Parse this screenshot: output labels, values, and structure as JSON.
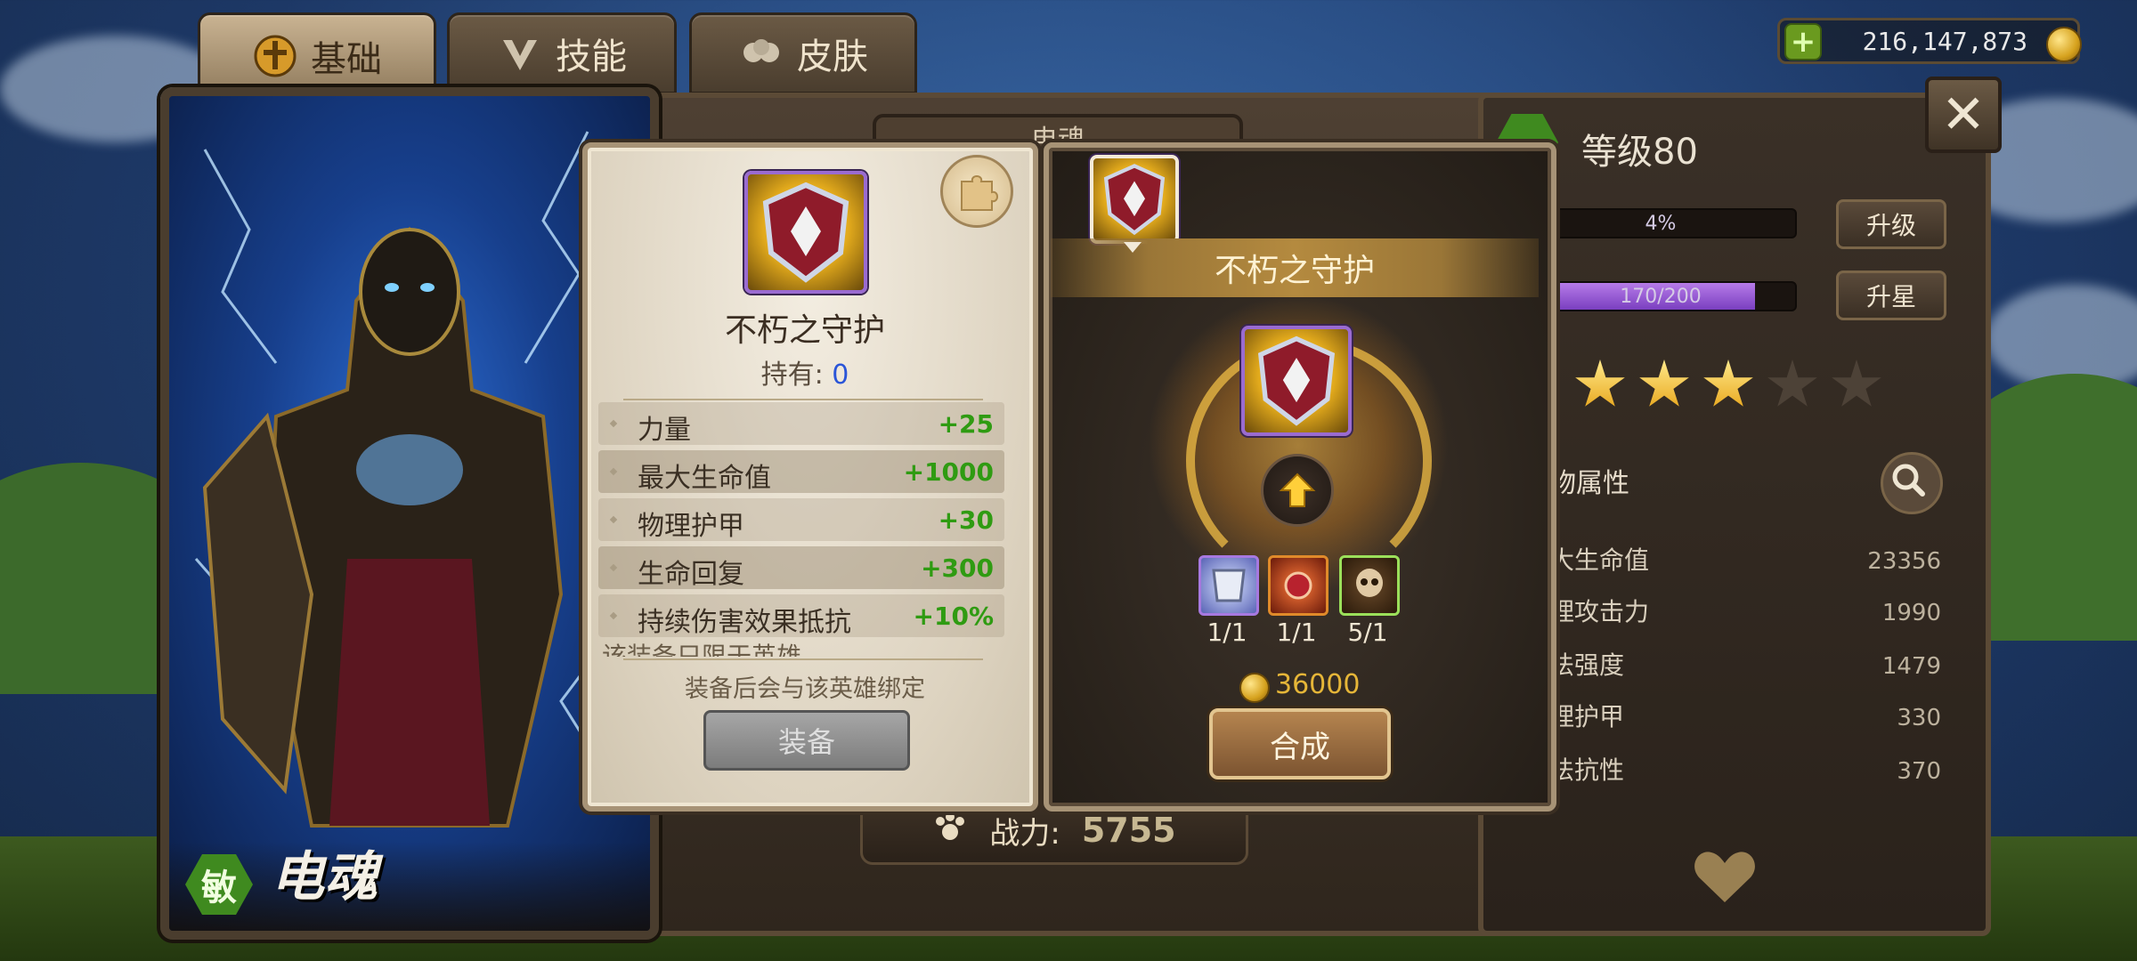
{
  "tabs": [
    {
      "label": "基础",
      "icon": "helmet-icon",
      "active": true
    },
    {
      "label": "技能",
      "icon": "skill-icon",
      "active": false
    },
    {
      "label": "皮肤",
      "icon": "skin-icon",
      "active": false
    }
  ],
  "currency": {
    "gold": "216,147,873"
  },
  "hero": {
    "class_badge": "敏",
    "name": "电魂"
  },
  "center_panel": {
    "title": "电魂",
    "power_label": "战力:",
    "power_value": "5755"
  },
  "stats": {
    "level": "等级80",
    "exp_percent": "4%",
    "exp_fraction": 0.04,
    "soul_text": "170/200",
    "soul_fraction": 0.85,
    "upgrade_btn": "升级",
    "starup_btn": "升星",
    "stars_filled": 3,
    "stars_total": 5,
    "attr_header": "物属性",
    "attrs": [
      {
        "label": "大生命值",
        "value": "23356"
      },
      {
        "label": "理攻击力",
        "value": "1990"
      },
      {
        "label": "法强度",
        "value": "1479"
      },
      {
        "label": "理护甲",
        "value": "330"
      },
      {
        "label": "法抗性",
        "value": "370"
      }
    ]
  },
  "item_card": {
    "name": "不朽之守护",
    "own_label": "持有:",
    "own_count": "0",
    "attributes": [
      {
        "label": "力量",
        "value": "+25"
      },
      {
        "label": "最大生命值",
        "value": "+1000"
      },
      {
        "label": "物理护甲",
        "value": "+30"
      },
      {
        "label": "生命回复",
        "value": "+300"
      },
      {
        "label": "持续伤害效果抵抗",
        "value": "+10%"
      }
    ],
    "cut_text": "该装备只限于英雄",
    "bind_note": "装备后会与该英雄绑定",
    "equip_btn": "装备"
  },
  "craft_card": {
    "name": "不朽之守护",
    "materials": [
      {
        "icon": "armor-material-icon",
        "count": "1/1"
      },
      {
        "icon": "fire-orb-material-icon",
        "count": "1/1"
      },
      {
        "icon": "skull-material-icon",
        "count": "5/1"
      }
    ],
    "cost": "36000",
    "craft_btn": "合成"
  },
  "colors": {
    "accent_gold": "#e6b638",
    "bonus_green": "#2f9b12",
    "own_blue": "#2a55d8"
  }
}
